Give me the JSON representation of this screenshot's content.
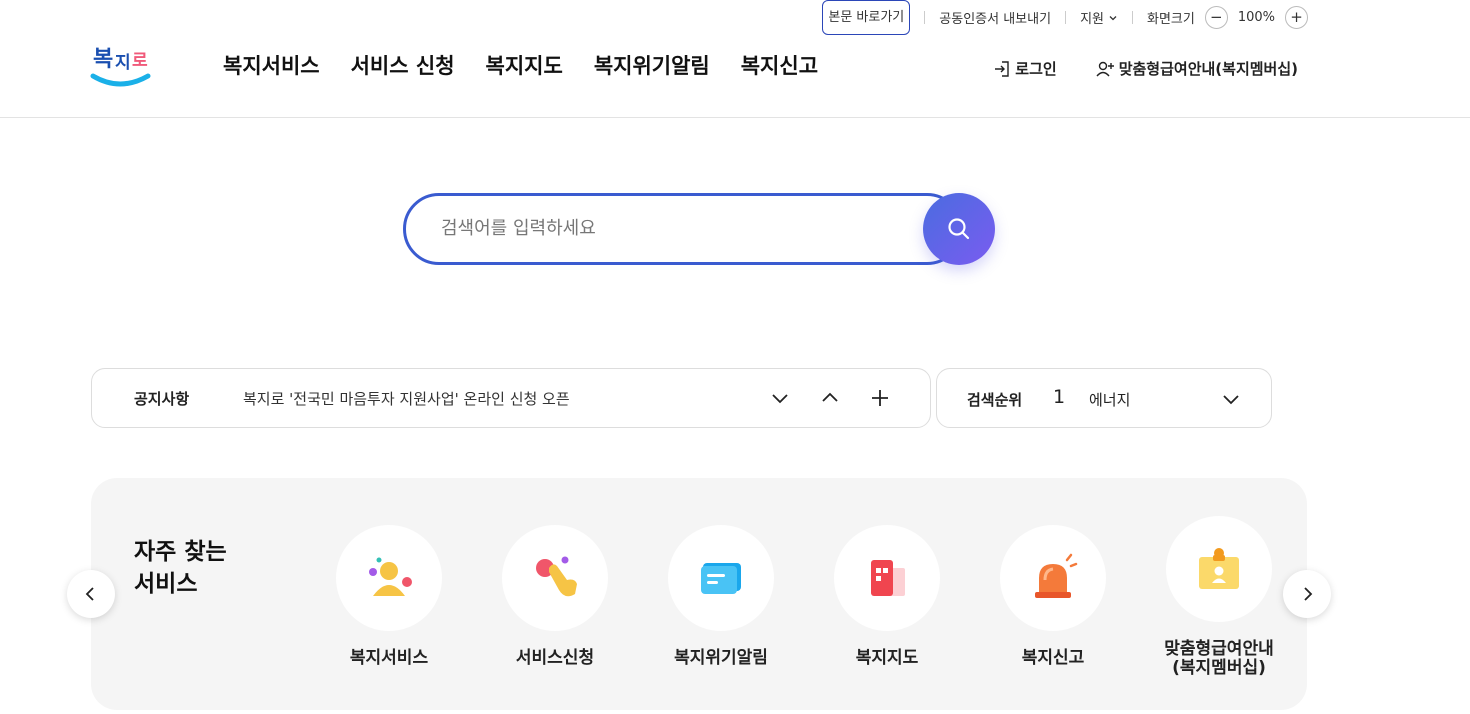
{
  "utility": {
    "skip_link": "본문 바로가기",
    "cert_export": "공동인증서 내보내기",
    "support": "지원",
    "screen_size": "화면크기",
    "zoom_minus": "−",
    "zoom_level": "100%",
    "zoom_plus": "+"
  },
  "header": {
    "logo_text": "복지로",
    "nav": [
      "복지서비스",
      "서비스 신청",
      "복지지도",
      "복지위기알림",
      "복지신고"
    ],
    "login": "로그인",
    "custom_benefit": "맞춤형급여안내(복지멤버십)"
  },
  "search": {
    "placeholder": "검색어를 입력하세요"
  },
  "notice": {
    "label": "공지사항",
    "text": "복지로 '전국민 마음투자 지원사업' 온라인 신청 오픈"
  },
  "rank": {
    "label": "검색순위",
    "number": "1",
    "keyword": "에너지"
  },
  "frequent": {
    "title_line1": "자주 찾는",
    "title_line2": "서비스",
    "items": [
      {
        "label": "복지서비스",
        "icon": "person-icon"
      },
      {
        "label": "서비스신청",
        "icon": "hand-tap-icon"
      },
      {
        "label": "복지위기알림",
        "icon": "message-icon"
      },
      {
        "label": "복지지도",
        "icon": "building-icon"
      },
      {
        "label": "복지신고",
        "icon": "siren-icon"
      },
      {
        "label": "맞춤형급여안내\n(복지멤버십)",
        "label_line1": "맞춤형급여안내",
        "label_line2": "(복지멤버십)",
        "icon": "id-card-icon"
      }
    ]
  },
  "colors": {
    "brand_blue": "#3a5bd0",
    "search_button_start": "#4a6ce0",
    "search_button_end": "#7a5cf0",
    "logo_cyan": "#1ab0e8"
  }
}
